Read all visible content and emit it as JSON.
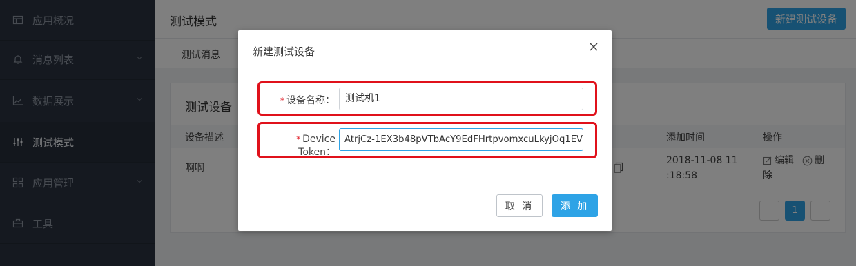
{
  "sidebar": {
    "items": [
      {
        "label": "应用概况",
        "icon": "app-overview-icon",
        "expandable": false
      },
      {
        "label": "消息列表",
        "icon": "bell-icon",
        "expandable": true
      },
      {
        "label": "数据展示",
        "icon": "area-chart-icon",
        "expandable": true
      },
      {
        "label": "测试模式",
        "icon": "sliders-icon",
        "expandable": false,
        "active": true
      },
      {
        "label": "应用管理",
        "icon": "grid-icon",
        "expandable": true
      },
      {
        "label": "工具",
        "icon": "toolbox-icon",
        "expandable": false
      }
    ]
  },
  "header": {
    "title": "测试模式",
    "new_device_button": "新建测试设备"
  },
  "tabs": {
    "test_message": "测试消息"
  },
  "card": {
    "title": "测试设备",
    "columns": {
      "description": "设备描述",
      "added_time": "添加时间",
      "actions": "操作"
    },
    "rows": [
      {
        "description": "啊啊",
        "added_time_line1": "2018-11-08 11",
        "added_time_line2": ":18:58",
        "edit": "编辑",
        "delete_line1": "删",
        "delete_line2": "除"
      }
    ],
    "pager": {
      "current": "1"
    }
  },
  "modal": {
    "title": "新建测试设备",
    "device_name_label": "设备名称：",
    "device_name_value": "测试机1",
    "device_token_label": "Device Token：",
    "device_token_value": "AtrjCz-1EX3b48pVTbAcY9EdFHrtpvomxcuLkyjOq1EV",
    "required_mark": "*",
    "cancel_button": "取 消",
    "add_button": "添 加"
  },
  "colors": {
    "accent": "#2ea3e6",
    "highlight": "#e0111b",
    "sidebar_bg": "#2a3340"
  }
}
